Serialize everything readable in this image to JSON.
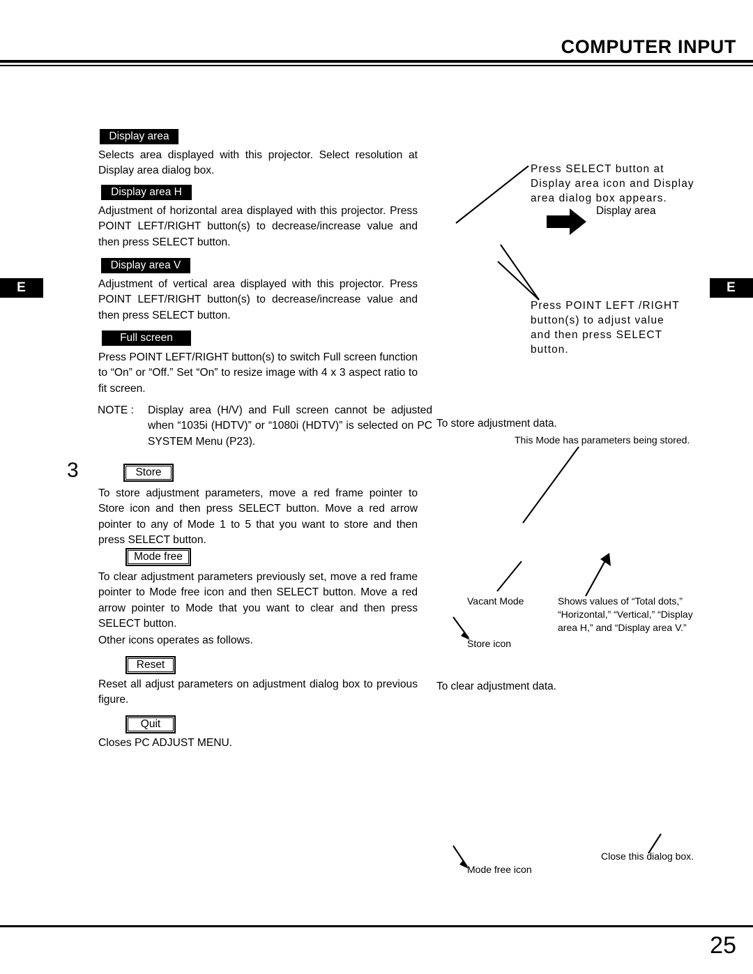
{
  "header": {
    "title": "COMPUTER INPUT"
  },
  "side_tabs": {
    "left_label": "E",
    "right_label": "E"
  },
  "footer": {
    "page_number": "25"
  },
  "left_column": {
    "sections": [
      {
        "label": "Display area",
        "label_style": "inverted",
        "body": "Selects area displayed with this projector. Select resolution at Display area dialog box."
      },
      {
        "label": "Display area H",
        "label_style": "inverted",
        "body": "Adjustment of horizontal area displayed with this projector.  Press POINT LEFT/RIGHT button(s) to decrease/increase value and then press SELECT button."
      },
      {
        "label": "Display area V",
        "label_style": "inverted",
        "body": "Adjustment of vertical area displayed with this projector.  Press POINT LEFT/RIGHT button(s) to decrease/increase value and then press SELECT button."
      },
      {
        "label": "Full screen",
        "label_style": "inverted",
        "body": "Press POINT LEFT/RIGHT button(s) to switch Full screen function to “On” or “Off.”  Set “On” to resize image with 4 x 3 aspect ratio to fit screen."
      }
    ],
    "note": {
      "label": "NOTE :",
      "text": "Display area (H/V) and Full screen cannot be adjusted when “1035i (HDTV)” or “1080i (HDTV)” is selected on PC SYSTEM Menu (P23)."
    },
    "step_number": "3",
    "step_sections": [
      {
        "label": "Store",
        "label_style": "boxed",
        "body": "To store adjustment parameters, move a red frame pointer to Store icon and then press SELECT button.  Move a red arrow pointer to any of Mode 1 to 5 that you want to store and then press SELECT button."
      },
      {
        "label": "Mode free",
        "label_style": "boxed",
        "body": "To clear adjustment parameters previously set, move a red frame pointer to Mode free icon and then SELECT button.  Move a red arrow pointer to Mode that you want to clear and then press SELECT button."
      }
    ],
    "other_icons_intro": "Other icons operates as follows.",
    "icon_sections": [
      {
        "label": "Reset",
        "label_style": "boxed",
        "body": "Reset all adjust parameters on adjustment dialog box to previous figure."
      },
      {
        "label": "Quit",
        "label_style": "boxed",
        "body": "Closes PC ADJUST MENU."
      }
    ]
  },
  "right_column": {
    "callout_select_button": "Press SELECT button at Display area icon and Display area dialog box appears.",
    "callout_display_area": "Display area",
    "callout_point_buttons": "Press POINT LEFT /RIGHT button(s) to adjust value and then press SELECT button.",
    "heading_store_data": "To store adjustment data.",
    "callout_mode_stored": "This Mode has parameters being stored.",
    "callout_vacant_mode": "Vacant Mode",
    "callout_shows_values": "Shows values of “Total dots,” “Horizontal,” “Vertical,” “Display area H,” and “Display area V.”",
    "callout_store_icon": "Store icon",
    "heading_clear_data": "To clear adjustment data.",
    "callout_mode_free_icon": "Mode free icon",
    "callout_close_dialog": "Close this dialog box."
  },
  "icons": {
    "block_arrow_right": "arrow-right-icon",
    "leader_line": "leader-line-icon"
  },
  "colors": {
    "ink": "#000000",
    "paper": "#ffffff"
  }
}
